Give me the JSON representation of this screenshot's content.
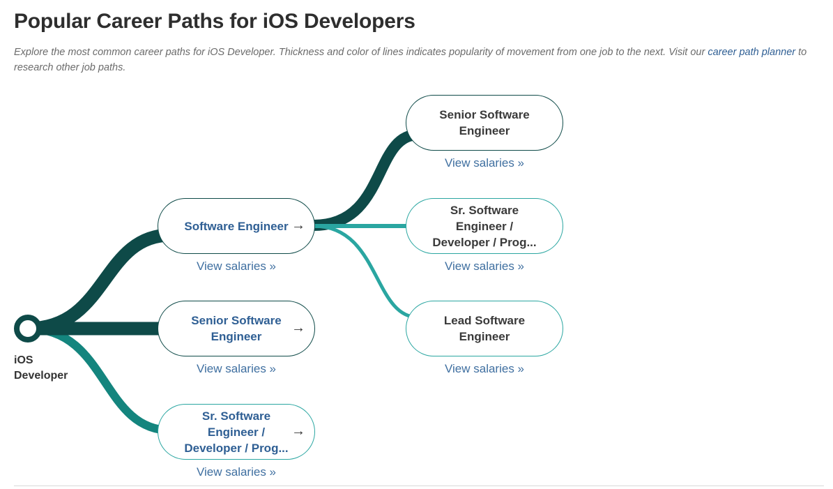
{
  "heading": "Popular Career Paths for iOS Developers",
  "intro": {
    "text": "Explore the most common career paths for iOS Developer. Thickness and color of lines indicates popularity of movement from one job to the next. Visit our ",
    "link_label": "career path planner",
    "text_after": " to research other job paths."
  },
  "colors": {
    "dark": "#0e4a48",
    "mid": "#14857e",
    "light": "#2aa6a1",
    "link": "#2f5f94"
  },
  "origin": {
    "label": "iOS Developer"
  },
  "first_level": [
    {
      "title": "Software Engineer",
      "salary_link": "View salaries »",
      "arrow_icon": "→"
    },
    {
      "title": "Senior Software Engineer",
      "salary_link": "View salaries »",
      "arrow_icon": "→"
    },
    {
      "title": "Sr. Software Engineer / Developer / Prog...",
      "salary_link": "View salaries »",
      "arrow_icon": "→"
    }
  ],
  "second_level": [
    {
      "title": "Senior Software Engineer",
      "salary_link": "View salaries »"
    },
    {
      "title": "Sr. Software Engineer / Developer / Prog...",
      "salary_link": "View salaries »"
    },
    {
      "title": "Lead Software Engineer",
      "salary_link": "View salaries »"
    }
  ]
}
